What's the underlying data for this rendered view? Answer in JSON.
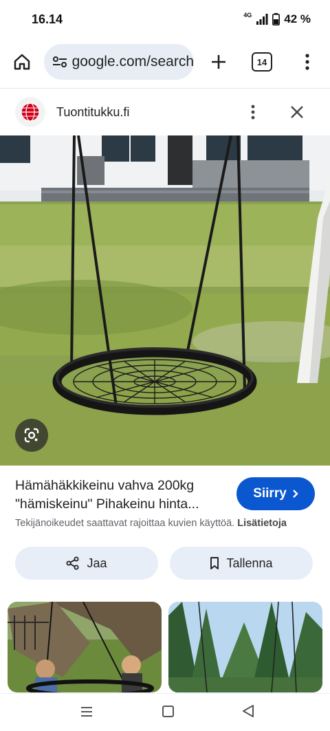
{
  "status": {
    "time": "16.14",
    "network": "4G",
    "battery": "42 %"
  },
  "toolbar": {
    "url": "google.com/search",
    "tab_count": "14"
  },
  "source": {
    "name": "Tuontitukku.fi"
  },
  "result": {
    "title_line1": "Hämähäkkikeinu vahva 200kg",
    "title_line2": "\"hämiskeinu\" Pihakeinu hinta...",
    "visit_label": "Siirry",
    "copyright_text": "Tekijänoikeudet saattavat rajoittaa kuvien käyttöä.",
    "copyright_link": "Lisätietoja"
  },
  "actions": {
    "share_label": "Jaa",
    "save_label": "Tallenna"
  },
  "icons": {
    "home": "home-icon",
    "tune": "tune-icon",
    "add": "plus-icon",
    "tabs": "tab-switcher-icon",
    "menu": "more-vert-icon",
    "close": "close-icon",
    "lens": "google-lens-icon",
    "share": "share-icon",
    "bookmark": "bookmark-icon",
    "chevron": "chevron-right-icon"
  },
  "colors": {
    "accent": "#0b57d0",
    "chip_bg": "#e8eef8",
    "url_bg": "#e8edf5"
  }
}
